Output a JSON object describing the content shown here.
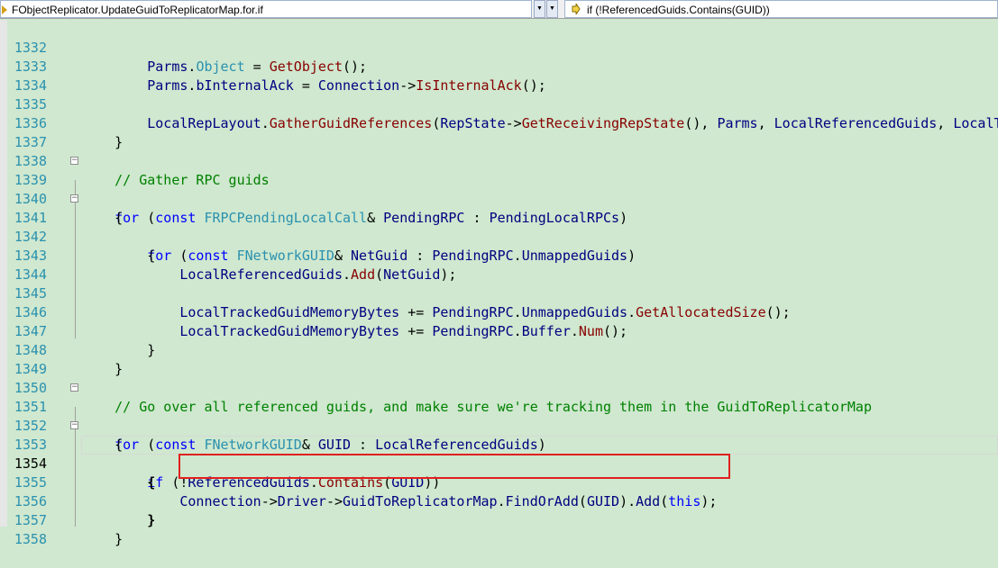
{
  "toolbar": {
    "context_selector": "FObjectReplicator.UpdateGuidToReplicatorMap.for.if",
    "member_selector": "if (!ReferencedGuids.Contains(GUID))",
    "dropdown_glyph": "▼"
  },
  "editor": {
    "current_line": "1354",
    "lines": [
      {
        "no": "1332"
      },
      {
        "no": "1333"
      },
      {
        "no": "1334"
      },
      {
        "no": "1335"
      },
      {
        "no": "1336"
      },
      {
        "no": "1337"
      },
      {
        "no": "1338"
      },
      {
        "no": "1339"
      },
      {
        "no": "1340"
      },
      {
        "no": "1341"
      },
      {
        "no": "1342"
      },
      {
        "no": "1343"
      },
      {
        "no": "1344"
      },
      {
        "no": "1345"
      },
      {
        "no": "1346"
      },
      {
        "no": "1347"
      },
      {
        "no": "1348"
      },
      {
        "no": "1349"
      },
      {
        "no": "1350"
      },
      {
        "no": "1351"
      },
      {
        "no": "1352"
      },
      {
        "no": "1353"
      },
      {
        "no": "1354"
      },
      {
        "no": "1355"
      },
      {
        "no": "1356"
      },
      {
        "no": "1357"
      },
      {
        "no": "1358"
      }
    ],
    "code": {
      "l1332": "        Parms.Object = GetObject();",
      "l1333": "        Parms.bInternalAck = Connection->IsInternalAck();",
      "l1335": "        LocalRepLayout.GatherGuidReferences(RepState->GetReceivingRepState(), Parms, LocalReferencedGuids, LocalT",
      "l1336": "    }",
      "l1338": "    // Gather RPC guids",
      "l1339": "    for (const FRPCPendingLocalCall& PendingRPC : PendingLocalRPCs)",
      "l1340": "    {",
      "l1341": "        for (const FNetworkGUID& NetGuid : PendingRPC.UnmappedGuids)",
      "l1342": "        {",
      "l1343": "            LocalReferencedGuids.Add(NetGuid);",
      "l1345": "            LocalTrackedGuidMemoryBytes += PendingRPC.UnmappedGuids.GetAllocatedSize();",
      "l1346": "            LocalTrackedGuidMemoryBytes += PendingRPC.Buffer.Num();",
      "l1347": "        }",
      "l1348": "    }",
      "l1350": "    // Go over all referenced guids, and make sure we're tracking them in the GuidToReplicatorMap",
      "l1351": "    for (const FNetworkGUID& GUID : LocalReferencedGuids)",
      "l1352": "    {",
      "l1353": "        if (!ReferencedGuids.Contains(GUID))",
      "l1354": "        {",
      "l1355": "            Connection->Driver->GuidToReplicatorMap.FindOrAdd(GUID).Add(this);",
      "l1356": "        }",
      "l1357": "    }"
    }
  },
  "colors": {
    "background": "#cfe8cf",
    "keyword": "#0000ff",
    "comment": "#008000",
    "type": "#2b91af",
    "function": "#880000",
    "line_number": "#2b91af",
    "highlight_box": "#e02020"
  }
}
